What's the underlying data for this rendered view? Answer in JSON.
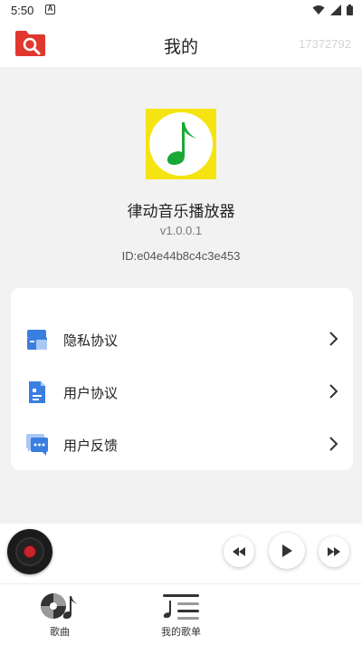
{
  "status": {
    "time": "5:50",
    "notification_letter": "A"
  },
  "header": {
    "title": "我的",
    "user_id": "17372792"
  },
  "about": {
    "app_name": "律动音乐播放器",
    "version": "v1.0.0.1",
    "device_id": "ID:e04e44b8c4c3e453"
  },
  "menu": {
    "items": [
      {
        "label": "隐私协议",
        "icon": "privacy-folder-icon"
      },
      {
        "label": "用户协议",
        "icon": "agreement-document-icon"
      },
      {
        "label": "用户反馈",
        "icon": "feedback-chat-icon"
      }
    ]
  },
  "player": {
    "controls": [
      "rewind-icon",
      "play-icon",
      "fast-forward-icon"
    ]
  },
  "nav": {
    "items": [
      {
        "label": "歌曲",
        "icon": "vinyl-music-note-icon"
      },
      {
        "label": "我的歌单",
        "icon": "playlist-icon"
      }
    ]
  },
  "colors": {
    "brand_red": "#e0382f",
    "logo_yellow": "#f6e312",
    "logo_green": "#1aa836",
    "icon_blue": "#3a7ee0",
    "background_gray": "#f2f2f2"
  }
}
